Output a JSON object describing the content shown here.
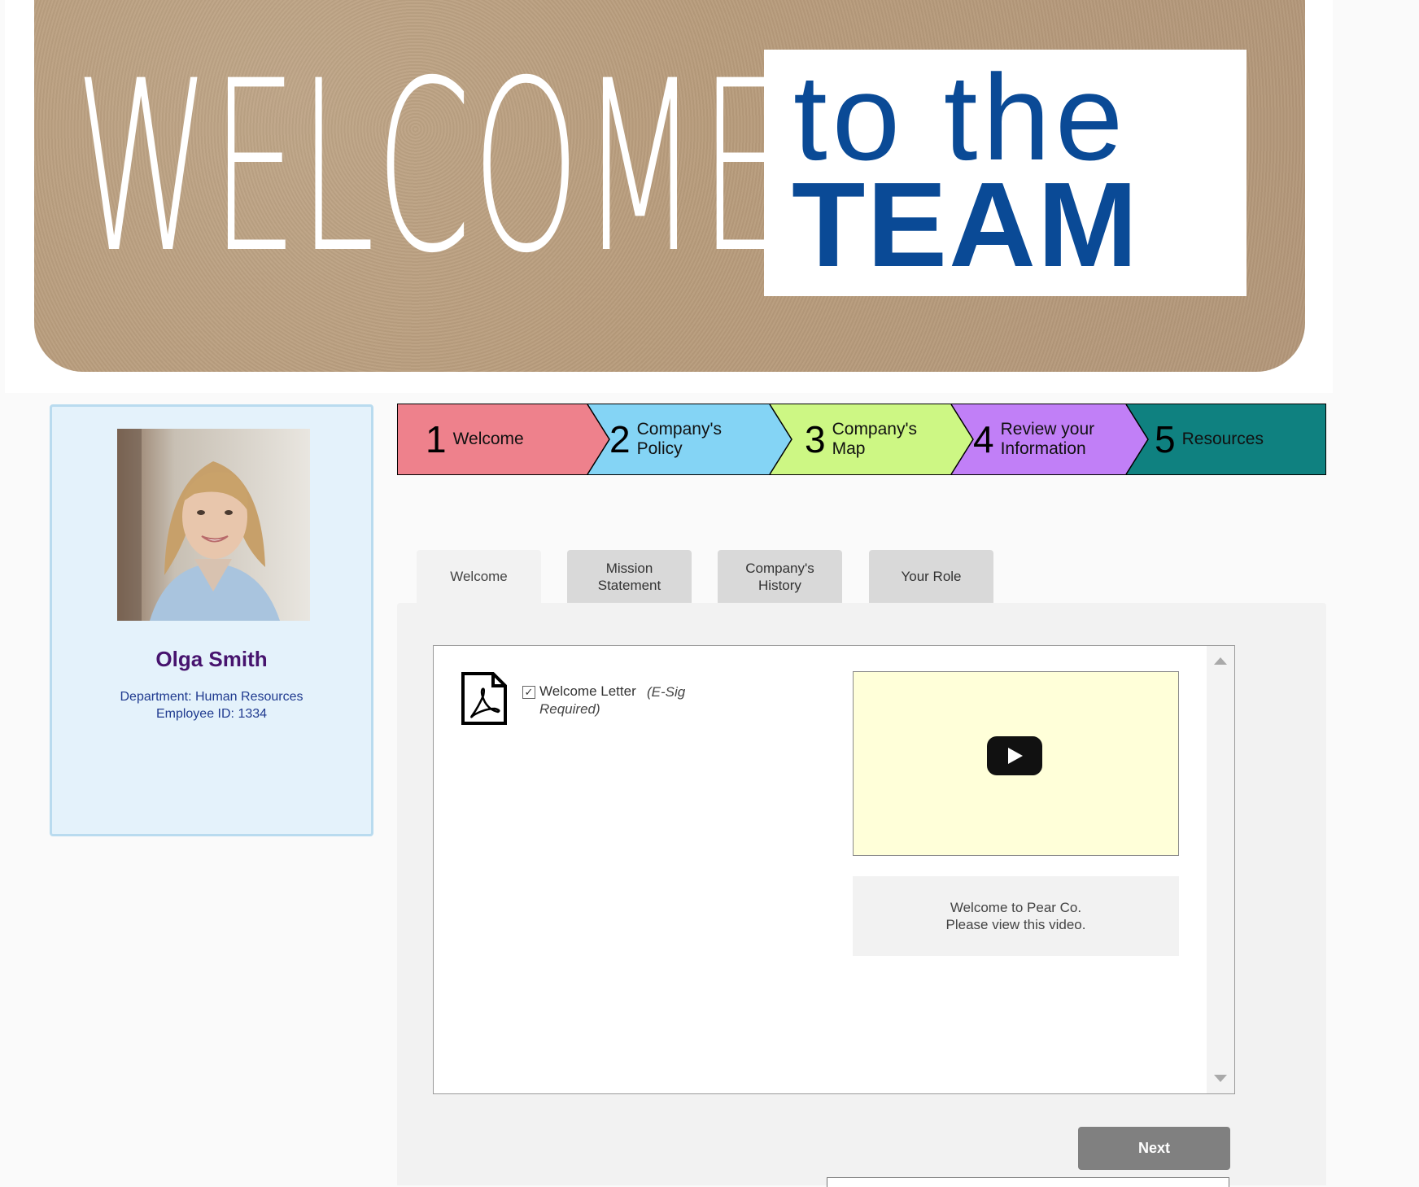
{
  "banner": {
    "welcome_text": "WELCOME",
    "to_the_text": "to the",
    "team_text": "TEAM",
    "colors": {
      "kraft": "#b3977a",
      "blue": "#0a4a96"
    }
  },
  "profile": {
    "name": "Olga Smith",
    "department": "Department: Human Resources",
    "employee_id": "Employee ID: 1334",
    "name_color": "#47146e"
  },
  "steps": [
    {
      "num": "1",
      "label": "Welcome",
      "color": "#ee818c"
    },
    {
      "num": "2",
      "label": "Company's Policy",
      "color": "#84d4f5"
    },
    {
      "num": "3",
      "label": "Company's Map",
      "color": "#cdf784"
    },
    {
      "num": "4",
      "label": "Review your Information",
      "color": "#c17ff7"
    },
    {
      "num": "5",
      "label": "Resources",
      "color": "#0f8180"
    }
  ],
  "tabs": [
    {
      "label": "Welcome",
      "active": true
    },
    {
      "label": "Mission\nStatement",
      "active": false
    },
    {
      "label": "Company's\nHistory",
      "active": false
    },
    {
      "label": "Your Role",
      "active": false
    }
  ],
  "content": {
    "document": {
      "label": "Welcome Letter",
      "note": "(E-Sig Required)",
      "checked": true,
      "icon": "pdf-icon"
    },
    "video": {
      "icon": "play-icon",
      "background": "#ffffd9"
    },
    "caption_line1": "Welcome to Pear Co.",
    "caption_line2": "Please view this video."
  },
  "next_button_label": "Next"
}
